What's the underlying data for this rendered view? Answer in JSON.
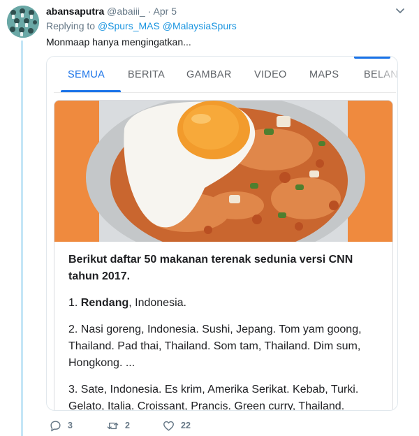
{
  "tweet": {
    "display_name": "abansaputra",
    "handle": "@abaiii_",
    "separator": "·",
    "date": "Apr 5",
    "replying_prefix": "Replying to",
    "mentions": [
      "@Spurs_MAS",
      "@MalaysiaSpurs"
    ],
    "text": "Monmaap hanya mengingatkan..."
  },
  "search_card": {
    "tabs": [
      {
        "label": "SEMUA",
        "active": true
      },
      {
        "label": "BERITA",
        "active": false
      },
      {
        "label": "GAMBAR",
        "active": false
      },
      {
        "label": "VIDEO",
        "active": false
      },
      {
        "label": "MAPS",
        "active": false
      },
      {
        "label": "BELANJA",
        "active": false
      }
    ],
    "snippet_lead": "Berikut daftar 50 makanan terenak sedunia versi CNN tahun 2017.",
    "list": [
      {
        "num": "1.",
        "bold": "Rendang",
        "rest": ", Indonesia."
      },
      {
        "num": "2.",
        "bold": "",
        "rest": "Nasi goreng, Indonesia. Sushi, Jepang. Tom yam goong, Thailand. Pad thai, Thailand. Som tam, Thailand. Dim sum, Hongkong. ..."
      },
      {
        "num": "3.",
        "bold": "",
        "rest": "Sate, Indonesia. Es krim, Amerika Serikat. Kebab, Turki. Gelato, Italia. Croissant, Prancis. Green curry, Thailand."
      }
    ]
  },
  "actions": {
    "replies": "3",
    "retweets": "2",
    "likes": "22"
  },
  "colors": {
    "accent_blue": "#1a73e8",
    "mention_blue": "#1b95e0",
    "thread_line": "#c4e6f7",
    "hero_orange": "#ef8a3e"
  }
}
